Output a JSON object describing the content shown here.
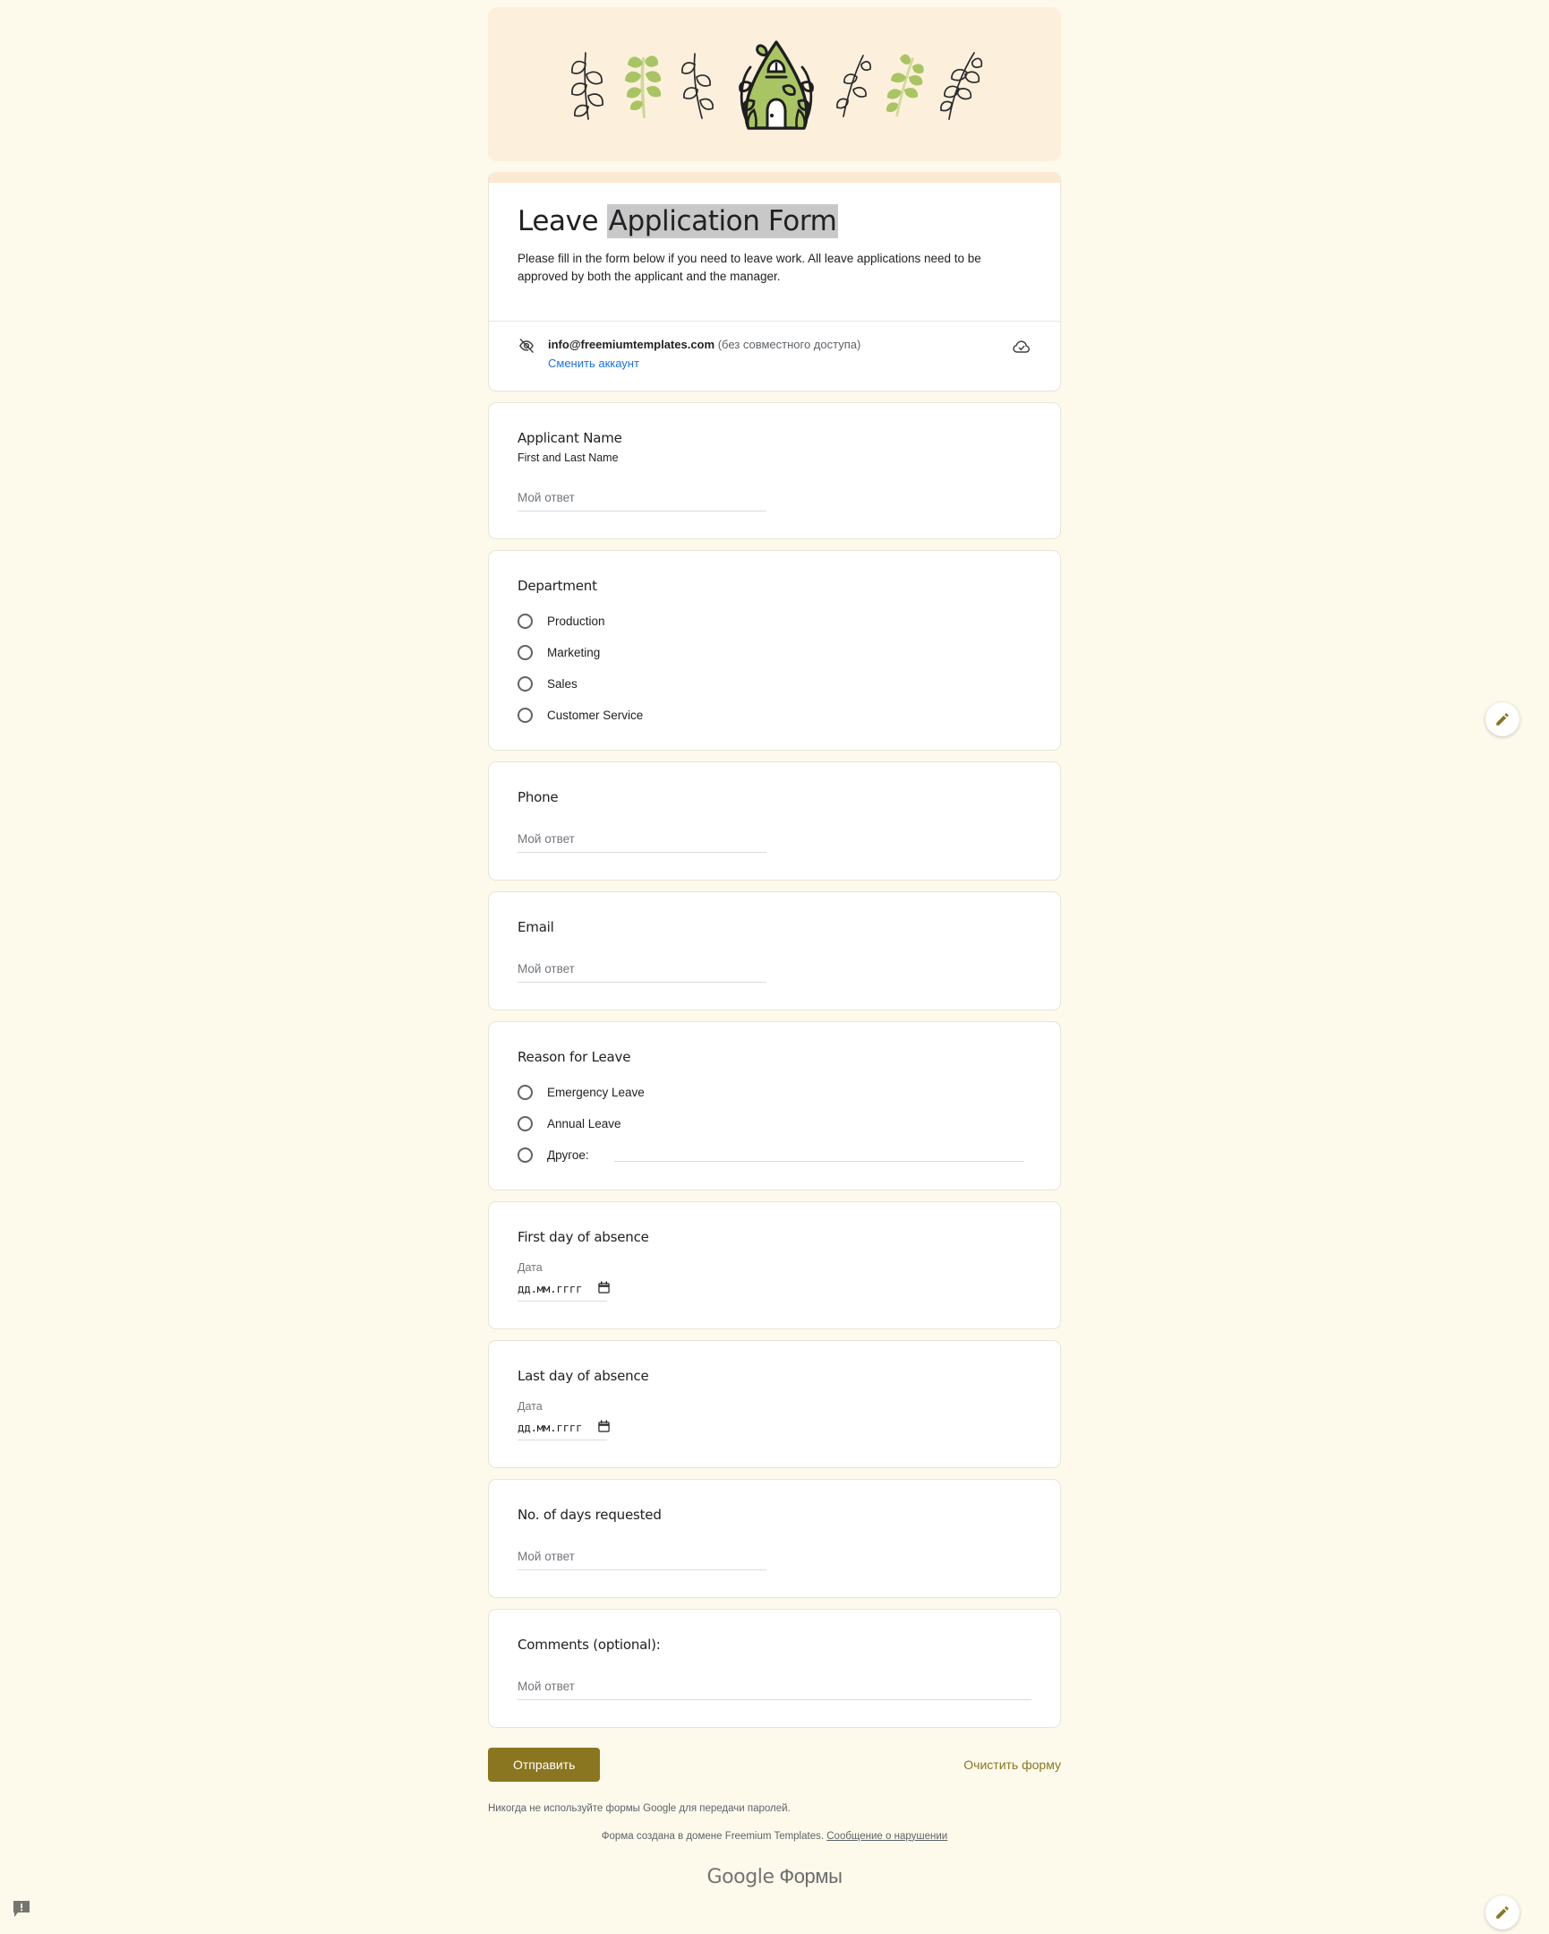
{
  "theme": {
    "accent": "#8a7520",
    "page_bg": "#fdfaec",
    "banner_bg": "#fcf0dd",
    "title_strip": "#fbe9d2",
    "leaf_green": "#a9c563",
    "link_blue": "#1a73e8"
  },
  "banner": {
    "alt": "decorative leaves and green house illustration",
    "items": [
      "sprig-outline-icon",
      "sprig-green-icon",
      "sprig-outline-icon",
      "house-icon",
      "sprig-outline-icon",
      "sprig-green-icon",
      "sprig-outline-icon"
    ]
  },
  "header": {
    "title_plain": "Leave ",
    "title_selected": "Application Form",
    "description": "Please fill in the form below if you need to leave work. All leave applications need to be approved by both the applicant and the manager.",
    "account": {
      "email": "info@freemiumtemplates.com",
      "sharing_note": "(без совместного доступа)",
      "switch_account": "Сменить аккаунт",
      "visibility_icon": "eye-off-icon",
      "saved_icon": "cloud-check-icon"
    }
  },
  "questions": [
    {
      "id": "applicant-name",
      "title": "Applicant Name",
      "subtitle": "First and Last Name",
      "type": "short-text",
      "placeholder": "Мой ответ"
    },
    {
      "id": "department",
      "title": "Department",
      "type": "radio",
      "options": [
        "Production",
        "Marketing",
        "Sales",
        "Customer Service"
      ]
    },
    {
      "id": "phone",
      "title": "Phone",
      "type": "short-text",
      "placeholder": "Мой ответ"
    },
    {
      "id": "email",
      "title": "Email",
      "type": "short-text",
      "placeholder": "Мой ответ"
    },
    {
      "id": "reason-for-leave",
      "title": "Reason for Leave",
      "type": "radio-with-other",
      "options": [
        "Emergency Leave",
        "Annual Leave"
      ],
      "other_label": "Другое:"
    },
    {
      "id": "first-day-of-absence",
      "title": "First day of absence",
      "type": "date",
      "sublabel": "Дата",
      "date_placeholder": "дд.мм.гггг"
    },
    {
      "id": "last-day-of-absence",
      "title": "Last day of absence",
      "type": "date",
      "sublabel": "Дата",
      "date_placeholder": "дд.мм.гггг"
    },
    {
      "id": "no-of-days-requested",
      "title": "No. of days requested",
      "type": "short-text",
      "placeholder": "Мой ответ"
    },
    {
      "id": "comments",
      "title": "Comments (optional):",
      "type": "paragraph",
      "placeholder": "Мой ответ"
    }
  ],
  "footer": {
    "submit_label": "Отправить",
    "clear_label": "Очистить форму",
    "password_warning": "Никогда не используйте формы Google для передачи паролей.",
    "domain_text": "Форма создана в домене Freemium Templates.",
    "report_link": "Сообщение о нарушении",
    "logo_google": "Google",
    "logo_forms": "Формы"
  },
  "floating": {
    "edit_icon": "pencil-icon",
    "feedback_icon": "feedback-icon"
  }
}
